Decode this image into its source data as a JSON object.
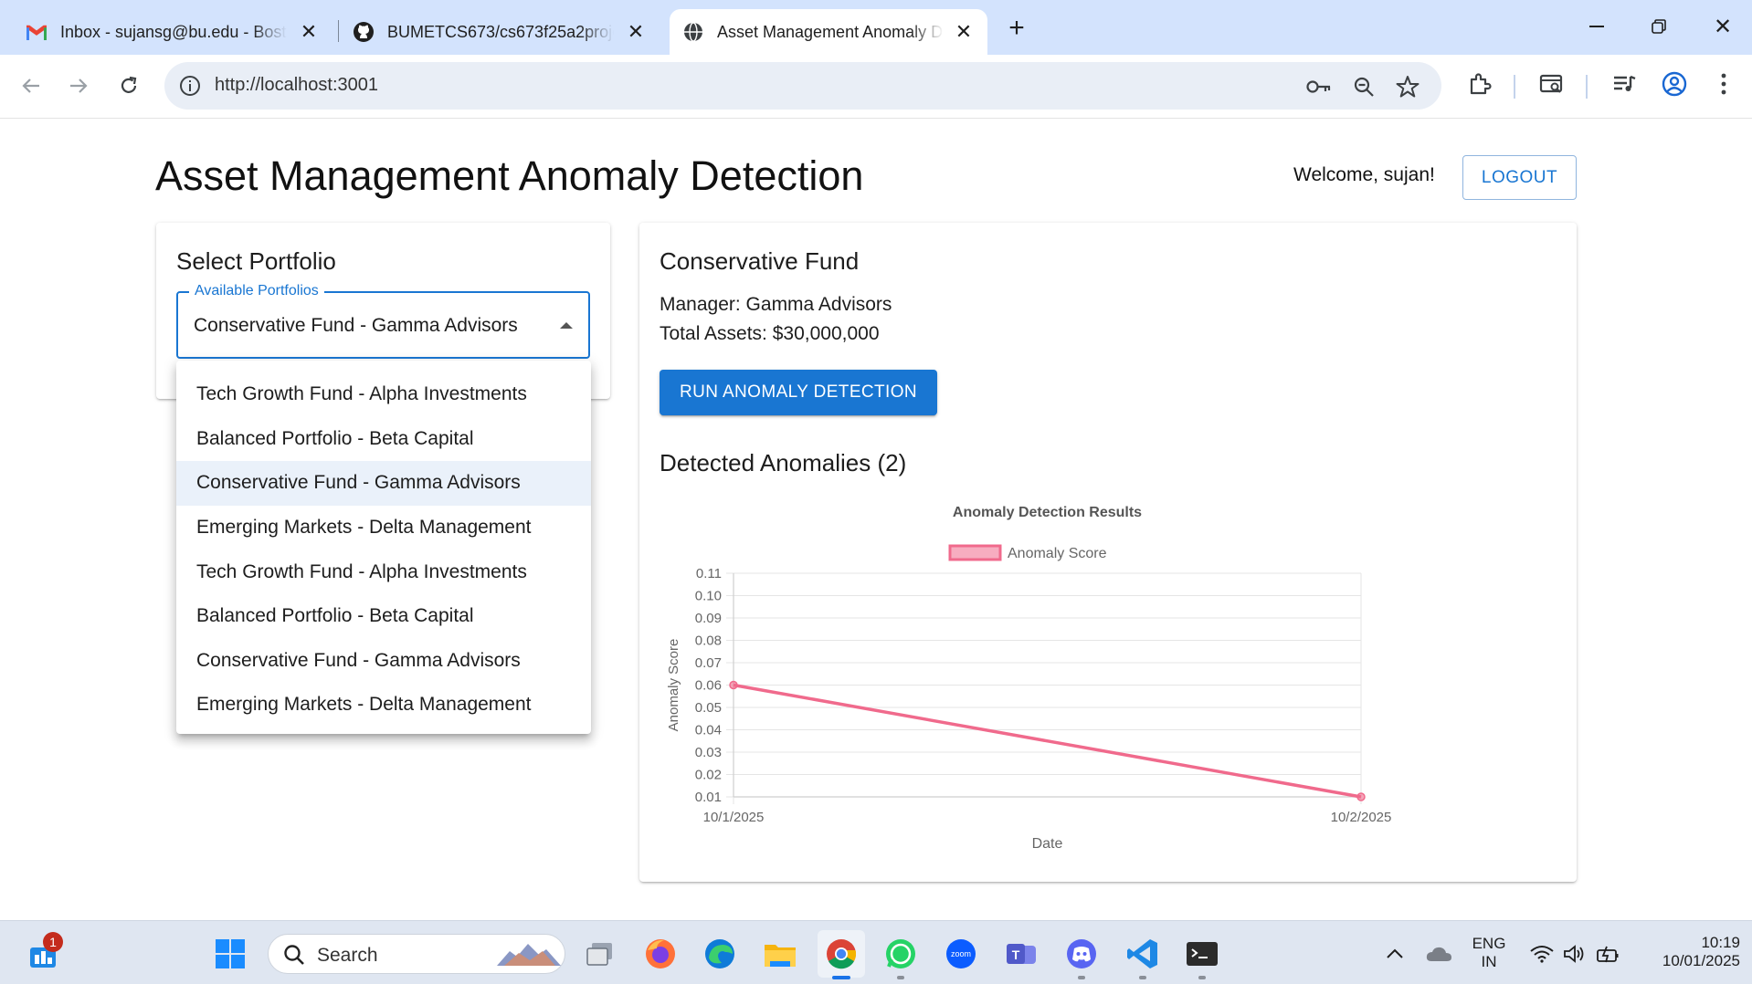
{
  "browser": {
    "tabs": [
      {
        "title": "Inbox - sujansg@bu.edu - Boston University Mail",
        "icon": "gmail-icon"
      },
      {
        "title": "BUMETCS673/cs673f25a2project",
        "icon": "github-icon"
      },
      {
        "title": "Asset Management Anomaly Detection",
        "icon": "globe-icon"
      }
    ],
    "url": "http://localhost:3001"
  },
  "header": {
    "title": "Asset Management Anomaly Detection",
    "welcome": "Welcome, sujan!",
    "logout": "LOGOUT"
  },
  "portfolio_select": {
    "heading": "Select Portfolio",
    "label": "Available Portfolios",
    "value": "Conservative Fund - Gamma Advisors",
    "options": [
      "Tech Growth Fund - Alpha Investments",
      "Balanced Portfolio - Beta Capital",
      "Conservative Fund - Gamma Advisors",
      "Emerging Markets - Delta Management",
      "Tech Growth Fund - Alpha Investments",
      "Balanced Portfolio - Beta Capital",
      "Conservative Fund - Gamma Advisors",
      "Emerging Markets - Delta Management"
    ],
    "highlighted_index": 2
  },
  "fund": {
    "name": "Conservative Fund",
    "manager": "Manager: Gamma Advisors",
    "assets": "Total Assets: $30,000,000",
    "run_button": "RUN ANOMALY DETECTION",
    "anomalies_heading": "Detected Anomalies (2)"
  },
  "chart_data": {
    "type": "line",
    "title": "Anomaly Detection Results",
    "xlabel": "Date",
    "ylabel": "Anomaly Score",
    "x": [
      "10/1/2025",
      "10/2/2025"
    ],
    "series": [
      {
        "name": "Anomaly Score",
        "values": [
          0.06,
          0.01
        ],
        "color": "#f06a8c"
      }
    ],
    "ylim": [
      0.01,
      0.11
    ],
    "yticks": [
      "0.11",
      "0.10",
      "0.09",
      "0.08",
      "0.07",
      "0.06",
      "0.05",
      "0.04",
      "0.03",
      "0.02",
      "0.01"
    ],
    "grid": true,
    "legend": "top"
  },
  "taskbar": {
    "search_placeholder": "Search",
    "notification_count": "1",
    "lang_top": "ENG",
    "lang_bottom": "IN",
    "time": "10:19",
    "date": "10/01/2025"
  }
}
